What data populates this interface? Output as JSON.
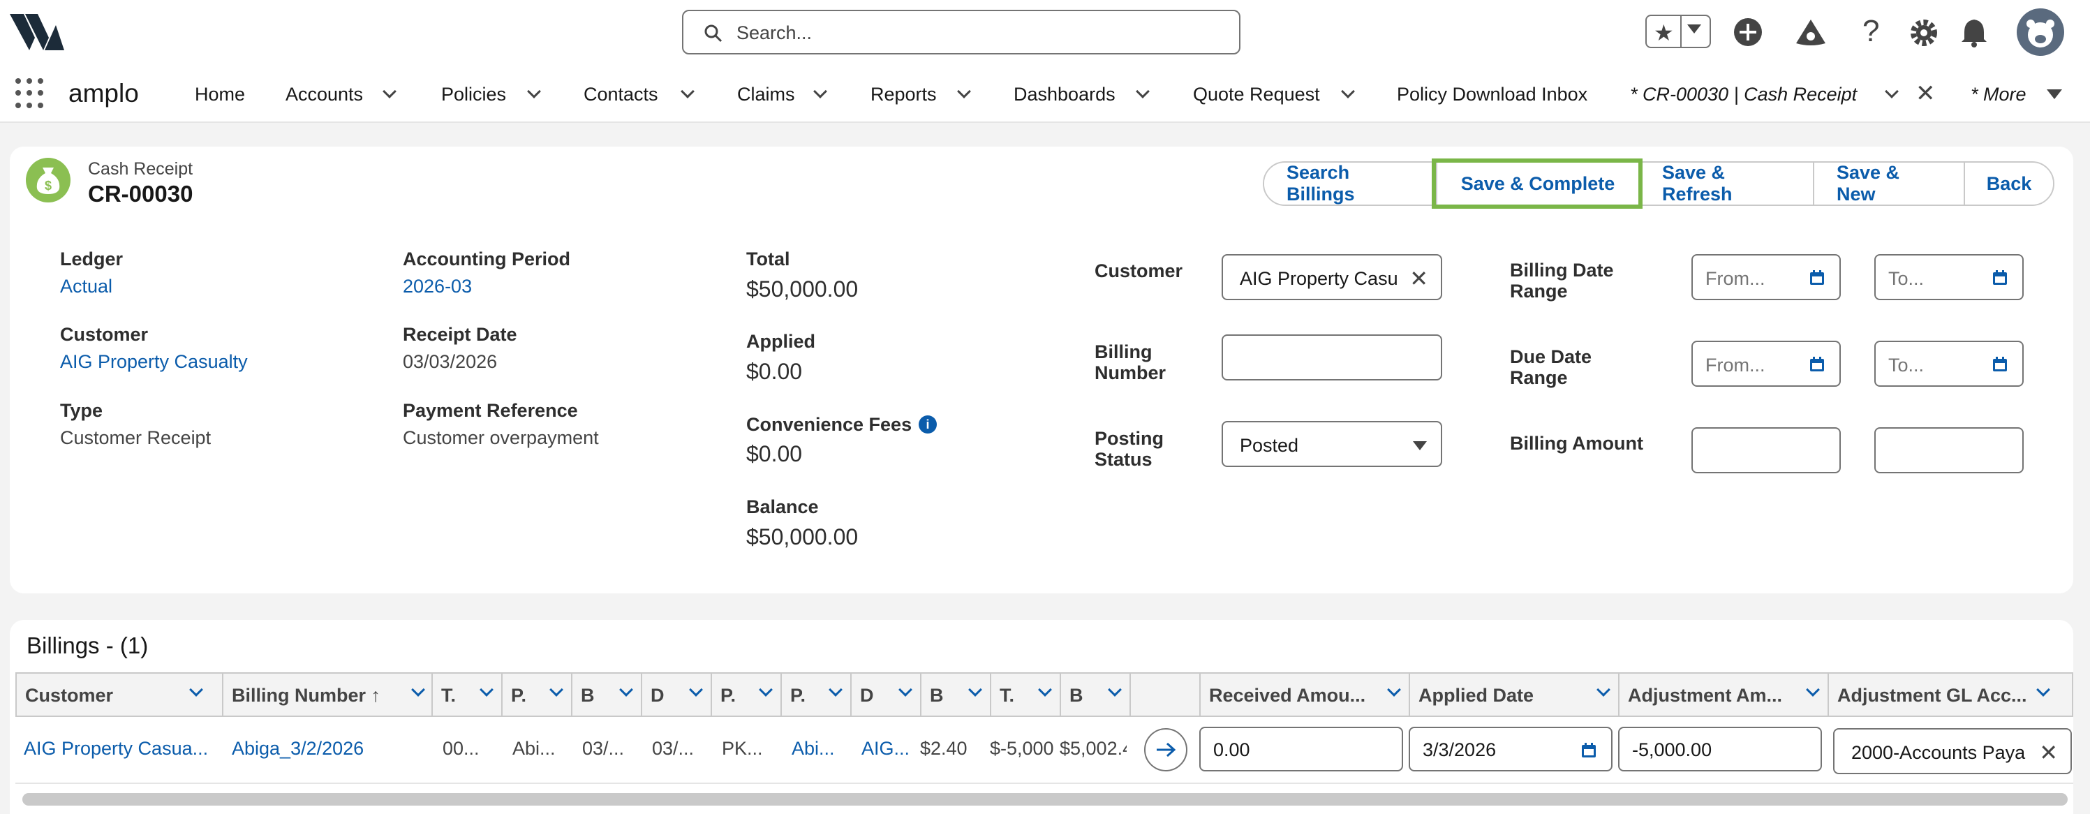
{
  "header": {
    "search_placeholder": "Search...",
    "app_name": "amplo",
    "nav": [
      "Home",
      "Accounts",
      "Policies",
      "Contacts",
      "Claims",
      "Reports",
      "Dashboards",
      "Quote Request",
      "Policy Download Inbox"
    ],
    "active_tab": "* CR-00030 | Cash Receipt",
    "more": "* More"
  },
  "record": {
    "type": "Cash Receipt",
    "title": "CR-00030",
    "buttons": [
      "Search Billings",
      "Save & Complete",
      "Save & Refresh",
      "Save & New",
      "Back"
    ]
  },
  "fields": {
    "ledger_label": "Ledger",
    "ledger_value": "Actual",
    "customer_label": "Customer",
    "customer_value": "AIG Property Casualty",
    "type_label": "Type",
    "type_value": "Customer Receipt",
    "period_label": "Accounting Period",
    "period_value": "2026-03",
    "receipt_date_label": "Receipt Date",
    "receipt_date_value": "03/03/2026",
    "payref_label": "Payment Reference",
    "payref_value": "Customer overpayment",
    "total_label": "Total",
    "total_value": "$50,000.00",
    "applied_label": "Applied",
    "applied_value": "$0.00",
    "fees_label": "Convenience Fees",
    "fees_value": "$0.00",
    "balance_label": "Balance",
    "balance_value": "$50,000.00"
  },
  "filters": {
    "customer_label": "Customer",
    "customer_value": "AIG Property Casu",
    "billing_number_label": "Billing Number",
    "posting_status_label": "Posting Status",
    "posting_status_value": "Posted",
    "billing_date_label": "Billing Date Range",
    "due_date_label": "Due Date Range",
    "billing_amount_label": "Billing Amount",
    "from_placeholder": "From...",
    "to_placeholder": "To..."
  },
  "billings": {
    "title": "Billings - (1)",
    "columns": [
      "Customer",
      "Billing Number ↑",
      "T.",
      "P.",
      "B",
      "D",
      "P.",
      "P.",
      "D",
      "B",
      "T.",
      "B",
      "",
      "Received Amou...",
      "Applied Date",
      "Adjustment Am...",
      "Adjustment GL Acc..."
    ],
    "row": {
      "customer": "AIG Property Casua...",
      "billing_number": "Abiga_3/2/2026",
      "c3": "00...",
      "c4": "Abi...",
      "c5": "03/...",
      "c6": "03/...",
      "c7": "PK...",
      "c8": "Abi...",
      "c9": "AIG...",
      "c10": "$2.40",
      "c11": "$-5,000",
      "c12": "$5,002.4",
      "received": "0.00",
      "applied_date": "3/3/2026",
      "adjustment": "-5,000.00",
      "gl_account": "2000-Accounts Paya"
    }
  }
}
